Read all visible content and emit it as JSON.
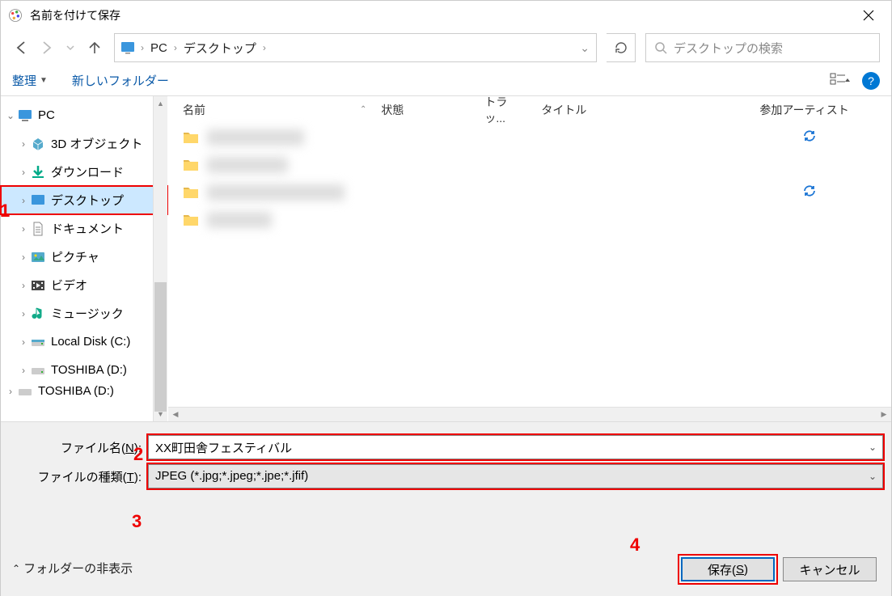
{
  "window": {
    "title": "名前を付けて保存"
  },
  "nav": {
    "breadcrumb": {
      "root": "PC",
      "current": "デスクトップ"
    },
    "search_placeholder": "デスクトップの検索"
  },
  "cmdbar": {
    "organize": "整理",
    "new_folder": "新しいフォルダー"
  },
  "tree": [
    {
      "label": "PC",
      "indent": 0,
      "expanded": true,
      "icon": "pc"
    },
    {
      "label": "3D オブジェクト",
      "indent": 1,
      "icon": "3d"
    },
    {
      "label": "ダウンロード",
      "indent": 1,
      "icon": "downloads"
    },
    {
      "label": "デスクトップ",
      "indent": 1,
      "icon": "desktop",
      "selected": true,
      "highlighted": true
    },
    {
      "label": "ドキュメント",
      "indent": 1,
      "icon": "documents"
    },
    {
      "label": "ピクチャ",
      "indent": 1,
      "icon": "pictures"
    },
    {
      "label": "ビデオ",
      "indent": 1,
      "icon": "videos"
    },
    {
      "label": "ミュージック",
      "indent": 1,
      "icon": "music"
    },
    {
      "label": "Local Disk (C:)",
      "indent": 1,
      "icon": "drive"
    },
    {
      "label": "TOSHIBA (D:)",
      "indent": 1,
      "icon": "drive"
    },
    {
      "label": "TOSHIBA (D:)",
      "indent": 0,
      "icon": "drive",
      "cut": true
    }
  ],
  "columns": {
    "name": "名前",
    "state": "状態",
    "track": "トラッ...",
    "title": "タイトル",
    "artist": "参加アーティスト"
  },
  "files": [
    {
      "sync": true
    },
    {
      "sync": false
    },
    {
      "sync": true
    },
    {
      "sync": false
    }
  ],
  "form": {
    "filename_label_pre": "ファイル名(",
    "filename_label_u": "N",
    "filename_label_post": "):",
    "filename_value": "XX町田舎フェスティバル",
    "filetype_label_pre": "ファイルの種類(",
    "filetype_label_u": "T",
    "filetype_label_post": "):",
    "filetype_value": "JPEG (*.jpg;*.jpeg;*.jpe;*.jfif)"
  },
  "buttons": {
    "save_pre": "保存(",
    "save_u": "S",
    "save_post": ")",
    "cancel": "キャンセル",
    "hide_folders": "フォルダーの非表示"
  },
  "annotations": {
    "a1": "1",
    "a2": "2",
    "a3": "3",
    "a4": "4"
  }
}
